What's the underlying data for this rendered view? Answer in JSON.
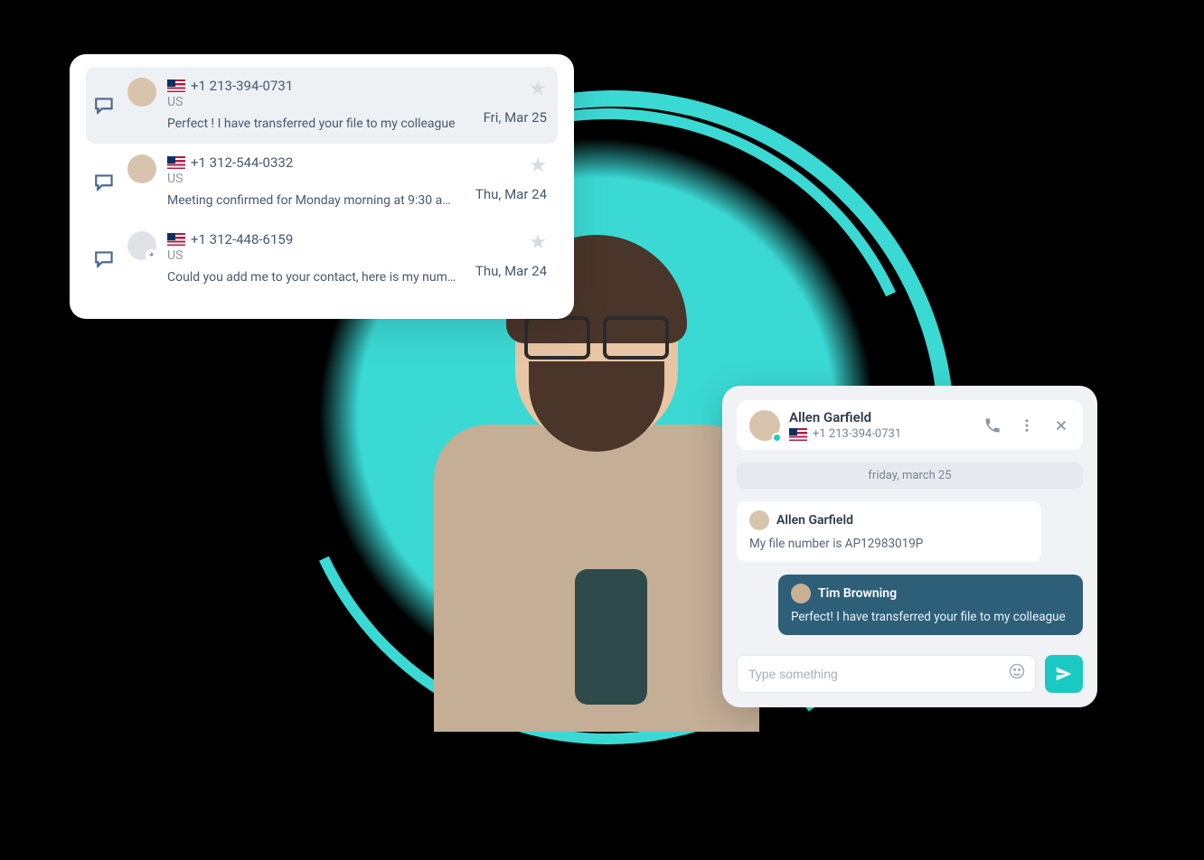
{
  "conversations": [
    {
      "phone": "+1 213-394-0731",
      "country": "US",
      "preview": "Perfect ! I have transferred your file to my colleague",
      "date": "Fri, Mar 25",
      "selected": true,
      "avatar_kind": "photo"
    },
    {
      "phone": "+1 312-544-0332",
      "country": "US",
      "preview": "Meeting confirmed for Monday morning at 9:30 am ....",
      "date": "Thu, Mar 24",
      "selected": false,
      "avatar_kind": "photo"
    },
    {
      "phone": "+1 312-448-6159",
      "country": "US",
      "preview": "Could you add me to your contact, here is my number...",
      "date": "Thu, Mar 24",
      "selected": false,
      "avatar_kind": "new"
    }
  ],
  "chat": {
    "contact_name": "Allen Garfield",
    "contact_phone": "+1 213-394-0731",
    "date_separator": "friday, march 25",
    "messages": [
      {
        "from": "Allen Garfield",
        "direction": "in",
        "text": "My file number is AP12983019P"
      },
      {
        "from": "Tim Browning",
        "direction": "out",
        "text": "Perfect! I have transferred your file to my colleague"
      }
    ],
    "compose_placeholder": "Type something"
  },
  "icons": {
    "message": "message-reply-icon",
    "star": "star-icon",
    "phone": "phone-icon",
    "menu": "menu-dots-icon",
    "close": "close-icon",
    "emoji": "emoji-icon",
    "send": "send-icon"
  },
  "colors": {
    "accent": "#1bc9c3",
    "brush": "#3bd9d4",
    "agent_bubble": "#2d5f79"
  }
}
